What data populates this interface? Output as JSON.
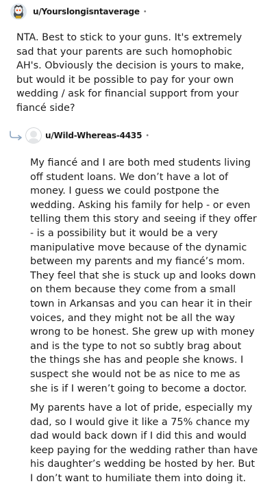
{
  "comments": [
    {
      "username": "u/Yourslongisntaverage",
      "meta": "•",
      "avatar_icon": "snoo-avatar-icon",
      "paragraphs": [
        "NTA. Best to stick to your guns. It's extremely sad that your parents are such homophobic AH's. Obviously the decision is yours to make, but would it be possible to pay for your own wedding / ask for financial support from your fiancé side?"
      ]
    },
    {
      "username": "u/Wild-Whereas-4435",
      "meta": "•",
      "avatar_icon": "default-avatar-icon",
      "reply_icon": "reply-arrow-icon",
      "paragraphs": [
        "My fiancé and I are both med students living off student loans. We don’t have a lot of money. I guess we could postpone the wedding. Asking his family for help - or even telling them this story and seeing if they offer - is a possibility but it would be a very manipulative move because of the dynamic between my parents and my fiancé’s mom. They feel that she is stuck up and looks down on them because they come from a small town in Arkansas and you can hear it in their voices, and they might not be all the way wrong to be honest. She grew up with money and is the type to not so subtly brag about the things she has and people she knows. I suspect she would not be as nice to me as she is if I weren’t going to become a doctor.",
        "My parents have a lot of pride, especially my dad, so I would give it like a 75% chance my dad would back down if I did this and would keep paying for the wedding rather than have his daughter’s wedding be hosted by her. But I don’t want to humiliate them into doing it."
      ]
    }
  ]
}
